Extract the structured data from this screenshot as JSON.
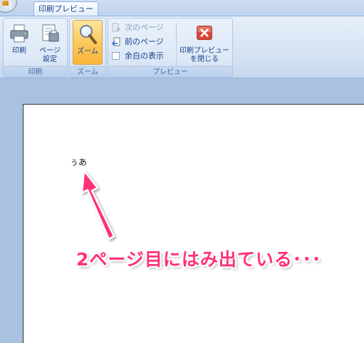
{
  "window": {
    "active_tab": "印刷プレビュー"
  },
  "ribbon": {
    "groups": {
      "print": {
        "label": "印刷",
        "print_button": "印刷",
        "page_setup_button_line1": "ページ",
        "page_setup_button_line2": "設定"
      },
      "zoom": {
        "label": "ズーム",
        "zoom_button": "ズーム"
      },
      "preview": {
        "label": "プレビュー",
        "next_page": "次のページ",
        "prev_page": "前のページ",
        "show_margins": "余白の表示",
        "close_line1": "印刷プレビュー",
        "close_line2": "を閉じる"
      }
    }
  },
  "document": {
    "page_text": "ぅあ"
  },
  "annotation": {
    "text": "2ページ目にはみ出ている･･･",
    "color": "#ff3377"
  },
  "icons": [
    "printer-icon",
    "page-setup-icon",
    "magnifier-icon",
    "next-page-icon",
    "prev-page-icon",
    "close-preview-icon"
  ]
}
